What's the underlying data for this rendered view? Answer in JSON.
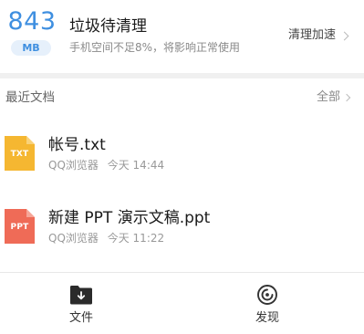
{
  "cleanup": {
    "storage_value": "843",
    "storage_unit": "MB",
    "title": "垃圾待清理",
    "subtitle": "手机空间不足8%，将影响正常使用",
    "action_label": "清理加速"
  },
  "recent": {
    "title": "最近文档",
    "all_label": "全部"
  },
  "files": [
    {
      "name": "帐号.txt",
      "ext_badge": "TXT",
      "icon_color": "#f5b731",
      "source": "QQ浏览器",
      "time": "今天 14:44"
    },
    {
      "name": "新建 PPT 演示文稿.ppt",
      "ext_badge": "PPT",
      "icon_color": "#ef6b57",
      "source": "QQ浏览器",
      "time": "今天 11:22"
    }
  ],
  "bottom_nav": {
    "files_label": "文件",
    "discover_label": "发现"
  },
  "colors": {
    "accent": "#3f8fe0"
  },
  "icons": {
    "files_tab": "folder-download-icon",
    "discover_tab": "compass-icon",
    "txt_file": "txt-file-icon",
    "ppt_file": "ppt-file-icon"
  }
}
